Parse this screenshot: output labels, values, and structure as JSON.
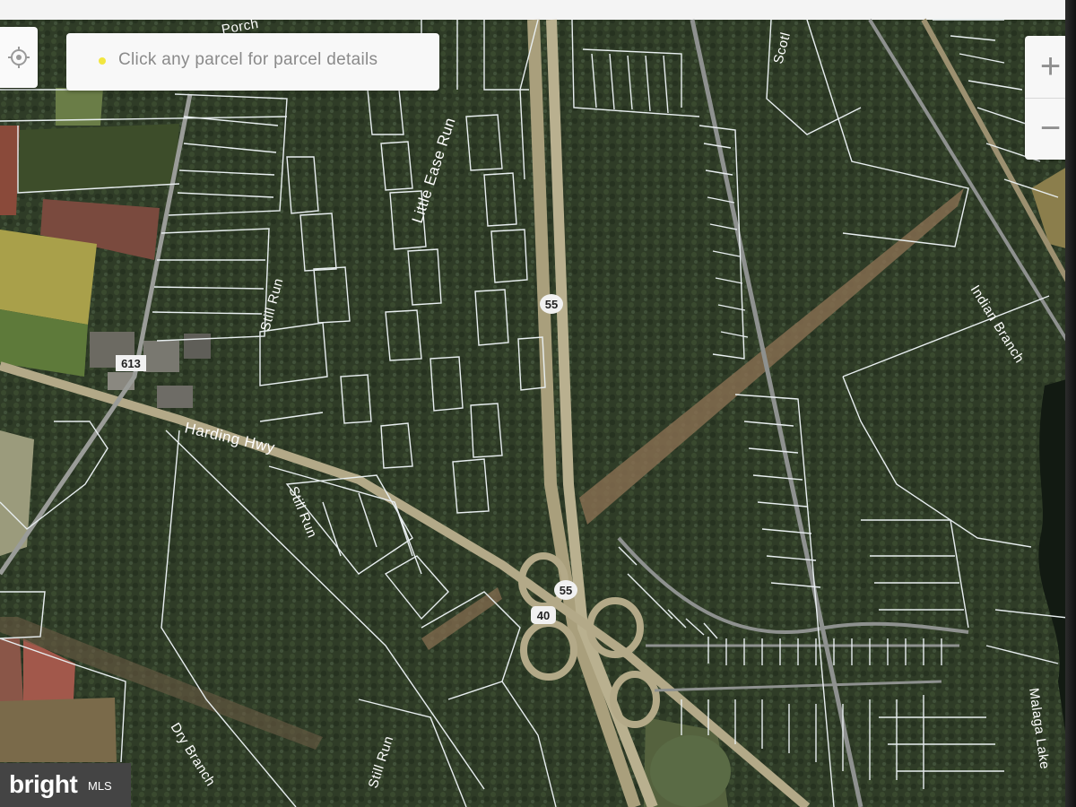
{
  "info_panel": {
    "message": "Click any parcel for parcel details"
  },
  "zoom": {
    "in_label": "+",
    "out_label": "−"
  },
  "badge": {
    "brand": "bright",
    "suffix": "MLS"
  },
  "roads": {
    "harding_hwy": "Harding Hwy",
    "little_ease_run": "Little Ease Run",
    "still_run_north": "Still Run",
    "still_run_mid": "Still Run",
    "still_run_south": "Still Run",
    "dry_branch": "Dry Branch",
    "indian_branch": "Indian Branch",
    "malaga_lake": "Malaga Lake",
    "scotland": "Scotl",
    "road_top": "Porch"
  },
  "shields": {
    "i55_north": "55",
    "i55_south": "55",
    "us40": "40",
    "cr613": "613"
  },
  "colors": {
    "forest": "#2e3b26",
    "field_green": "#7d8c3e",
    "field_yellow": "#b9b04a",
    "field_brown": "#8a5648",
    "highway": "#b8ad86",
    "parcel_line": "#e8eef0",
    "water": "#0f1510"
  }
}
